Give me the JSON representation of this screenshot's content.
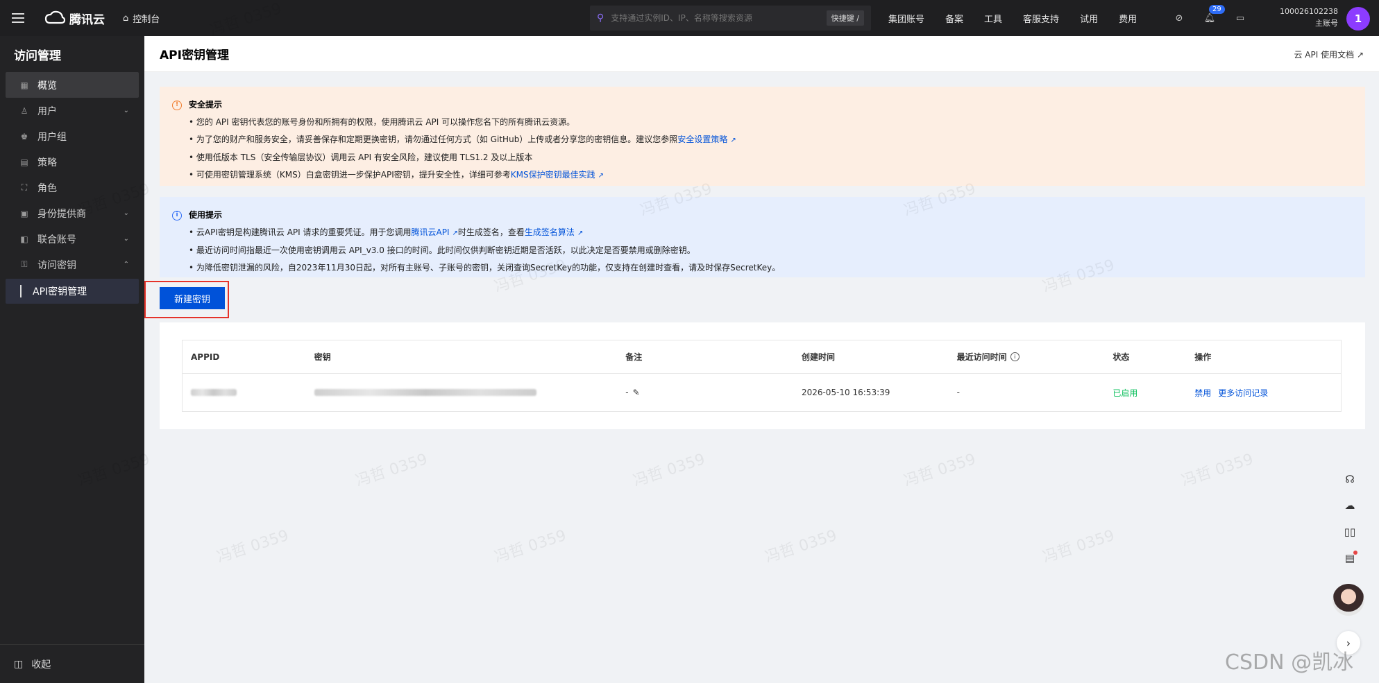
{
  "topbar": {
    "brand": "腾讯云",
    "console": "控制台",
    "search_placeholder": "支持通过实例ID、IP、名称等搜索资源",
    "shortcut": "快捷键 /",
    "nav": [
      "集团账号",
      "备案",
      "工具",
      "客服支持",
      "试用",
      "费用"
    ],
    "notification_count": "29",
    "account_id": "100026102238",
    "account_role": "主账号",
    "avatar_initial": "1"
  },
  "sidebar": {
    "title": "访问管理",
    "items": [
      {
        "label": "概览",
        "icon": "grid-icon",
        "active": true
      },
      {
        "label": "用户",
        "icon": "user-icon",
        "chevron": "⌄"
      },
      {
        "label": "用户组",
        "icon": "group-icon"
      },
      {
        "label": "策略",
        "icon": "policy-icon"
      },
      {
        "label": "角色",
        "icon": "role-icon"
      },
      {
        "label": "身份提供商",
        "icon": "idp-icon",
        "chevron": "⌄"
      },
      {
        "label": "联合账号",
        "icon": "federated-icon",
        "chevron": "⌄"
      },
      {
        "label": "访问密钥",
        "icon": "key-icon",
        "chevron": "⌃"
      }
    ],
    "sub_item": "API密钥管理",
    "collapse": "收起"
  },
  "page": {
    "title": "API密钥管理",
    "doc_link": "云 API 使用文档"
  },
  "security_alert": {
    "title": "安全提示",
    "l1": "您的 API 密钥代表您的账号身份和所拥有的权限，使用腾讯云 API 可以操作您名下的所有腾讯云资源。",
    "l2_pre": "为了您的财产和服务安全，请妥善保存和定期更换密钥，请勿通过任何方式（如 GitHub）上传或者分享您的密钥信息。建议您参照",
    "l2_link": "安全设置策略",
    "l3": "使用低版本 TLS（安全传输层协议）调用云 API 有安全风险，建议使用 TLS1.2 及以上版本",
    "l4_pre": "可使用密钥管理系统（KMS）白盒密钥进一步保护API密钥，提升安全性，详细可参考",
    "l4_link": "KMS保护密钥最佳实践"
  },
  "usage_alert": {
    "title": "使用提示",
    "l1_pre": "云API密钥是构建腾讯云 API 请求的重要凭证。用于您调用",
    "l1_link1": "腾讯云API",
    "l1_mid": "时生成签名，查看",
    "l1_link2": "生成签名算法",
    "l2": "最近访问时间指最近一次使用密钥调用云 API_v3.0 接口的时间。此时间仅供判断密钥近期是否活跃，以此决定是否要禁用或删除密钥。",
    "l3": "为降低密钥泄漏的风险，自2023年11月30日起，对所有主账号、子账号的密钥，关闭查询SecretKey的功能，仅支持在创建时查看，请及时保存SecretKey。"
  },
  "create_button": "新建密钥",
  "table": {
    "headers": [
      "APPID",
      "密钥",
      "备注",
      "创建时间",
      "最近访问时间",
      "状态",
      "操作"
    ],
    "rows": [
      {
        "remark": "-",
        "created": "2026-05-10 16:53:39",
        "last_access": "-",
        "status": "已启用",
        "op1": "禁用",
        "op2": "更多访问记录"
      }
    ]
  },
  "watermark_text": "冯哲 0359",
  "footer_mark": "CSDN @凯冰"
}
